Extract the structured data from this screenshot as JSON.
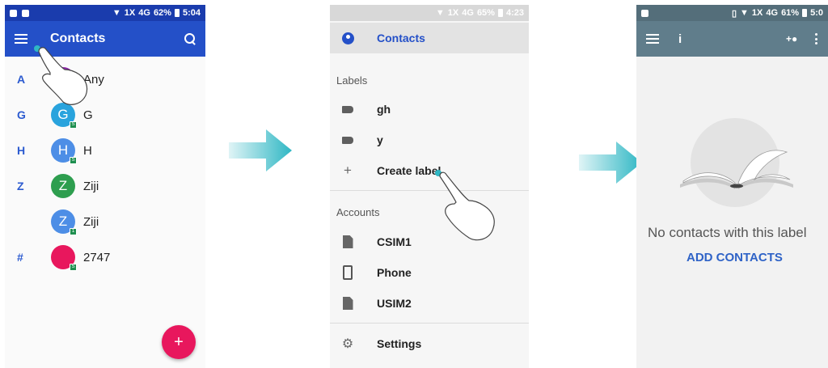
{
  "colors": {
    "contacts_appbar": "#2450c8",
    "contacts_statusbar": "#1a3cad",
    "accent_letter": "#2c5bd0",
    "fab": "#e8175d",
    "arrow": "#2fb7c4",
    "label_appbar": "#607d8b",
    "link": "#2f63c7"
  },
  "screen1": {
    "status": {
      "signal": "1X",
      "network": "4G",
      "battery": "62%",
      "time": "5:04"
    },
    "title": "Contacts",
    "icons": {
      "menu": "menu-icon",
      "search": "search-icon"
    },
    "contacts": [
      {
        "letter": "A",
        "avatar": "",
        "avatar_color": "#8e24aa",
        "name": "Any",
        "badge": ""
      },
      {
        "letter": "G",
        "avatar": "G",
        "avatar_color": "#29a3dd",
        "name": "G",
        "badge": "S"
      },
      {
        "letter": "H",
        "avatar": "H",
        "avatar_color": "#4d8ee6",
        "name": "H",
        "badge": "S"
      },
      {
        "letter": "Z",
        "avatar": "Z",
        "avatar_color": "#2e9e4f",
        "name": "Ziji",
        "badge": ""
      },
      {
        "letter": "",
        "avatar": "Z",
        "avatar_color": "#4d8ee6",
        "name": "Ziji",
        "badge": "1"
      },
      {
        "letter": "#",
        "avatar": "",
        "avatar_color": "#e8175d",
        "name": "2747",
        "badge": "S"
      }
    ],
    "fab_label": "+"
  },
  "screen2": {
    "status": {
      "signal": "1X",
      "network": "4G",
      "battery": "65%",
      "time": "4:23"
    },
    "contacts_item": "Contacts",
    "labels_title": "Labels",
    "labels": [
      "gh",
      "y"
    ],
    "create_label": "Create label",
    "accounts_title": "Accounts",
    "accounts": [
      {
        "name": "CSIM1",
        "icon": "sim-icon"
      },
      {
        "name": "Phone",
        "icon": "phone-icon"
      },
      {
        "name": "USIM2",
        "icon": "sim-icon"
      }
    ],
    "settings": "Settings"
  },
  "screen3": {
    "status": {
      "signal": "1X",
      "network": "4G",
      "battery": "61%",
      "time": "5:0"
    },
    "title": "i",
    "empty_text": "No contacts with this label",
    "action": "ADD CONTACTS",
    "icons": {
      "menu": "menu-icon",
      "add_person": "add-person-icon",
      "more": "more-vert-icon"
    }
  }
}
